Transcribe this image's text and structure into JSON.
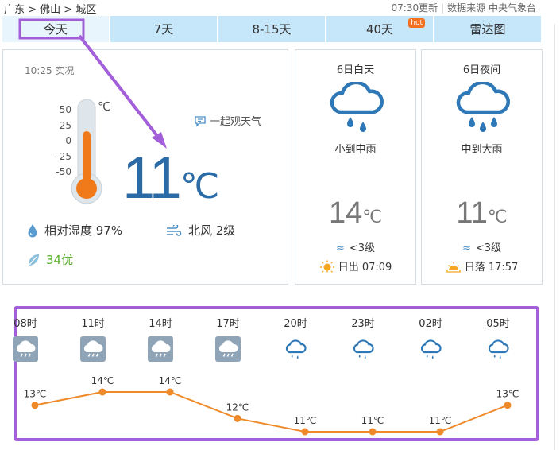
{
  "breadcrumb": "广东 > 佛山 > 城区",
  "update": {
    "time": "07:30更新",
    "source": "数据来源 中央气象台"
  },
  "tabs": [
    {
      "label": "今天",
      "active": true
    },
    {
      "label": "7天"
    },
    {
      "label": "8-15天"
    },
    {
      "label": "40天",
      "badge": "hot"
    },
    {
      "label": "雷达图"
    }
  ],
  "current": {
    "obs_time": "10:25 实况",
    "scale": [
      "50",
      "25",
      "0",
      "-25",
      "-50"
    ],
    "scale_unit": "℃",
    "temp": "11",
    "temp_unit": "℃",
    "watch_label": "一起观天气",
    "humidity": "相对湿度  97%",
    "wind": "北风  2级",
    "aqi": "34优"
  },
  "day": {
    "title": "6日白天",
    "desc": "小到中雨",
    "temp": "14",
    "temp_unit": "℃",
    "wind": "<3级",
    "sun": "日出 07:09"
  },
  "night": {
    "title": "6日夜间",
    "desc": "中到大雨",
    "temp": "11",
    "temp_unit": "℃",
    "wind": "<3级",
    "sun": "日落 17:57"
  },
  "hourly": [
    {
      "time": "08时",
      "temp": "13℃",
      "value": 13,
      "icon": "rain-icon-day"
    },
    {
      "time": "11时",
      "temp": "14℃",
      "value": 14,
      "icon": "rain-icon-day"
    },
    {
      "time": "14时",
      "temp": "14℃",
      "value": 14,
      "icon": "rain-icon-day"
    },
    {
      "time": "17时",
      "temp": "12℃",
      "value": 12,
      "icon": "rain-icon-day"
    },
    {
      "time": "20时",
      "temp": "11℃",
      "value": 11,
      "icon": "rain-icon-night"
    },
    {
      "time": "23时",
      "temp": "11℃",
      "value": 11,
      "icon": "rain-icon-night"
    },
    {
      "time": "02时",
      "temp": "11℃",
      "value": 11,
      "icon": "rain-icon-night"
    },
    {
      "time": "05时",
      "temp": "13℃",
      "value": 13,
      "icon": "rain-icon-night"
    }
  ],
  "colors": {
    "accent": "#2a6aa6",
    "line": "#ef8a2b",
    "tab": "#c6e6fa",
    "highlight": "#a35ed9",
    "aqi": "#5db02f"
  }
}
